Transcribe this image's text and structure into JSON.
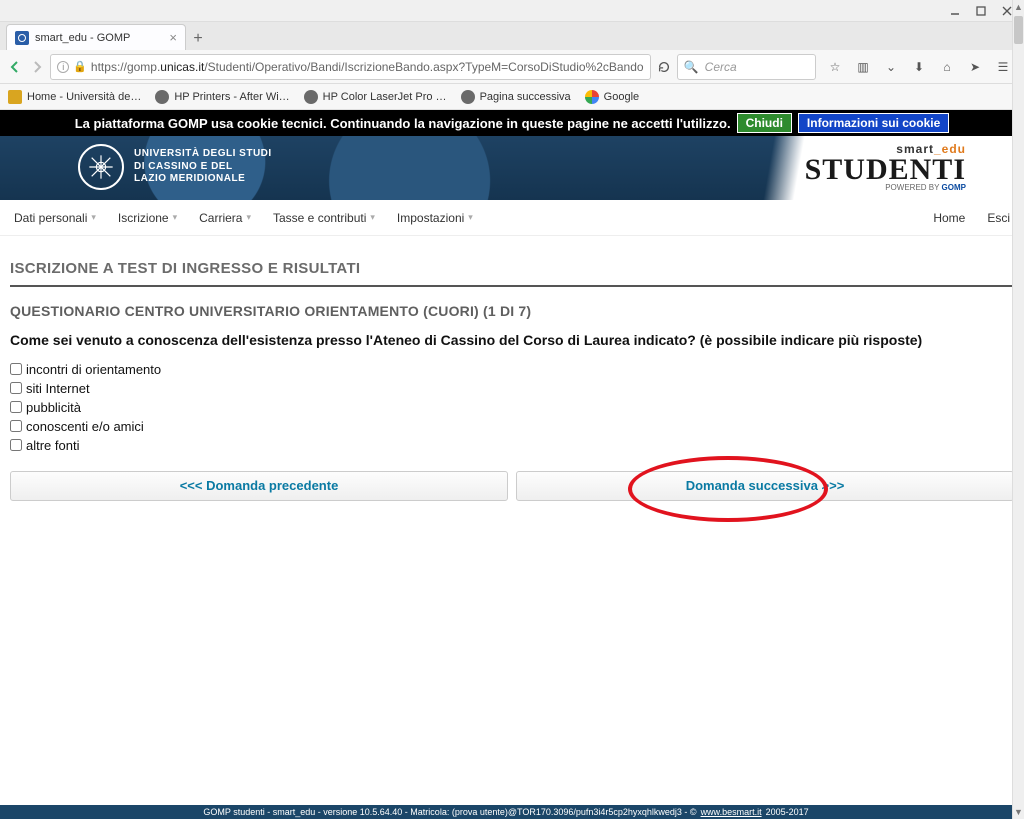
{
  "window": {
    "tab_title": "smart_edu - GOMP"
  },
  "nav": {
    "url_prefix": "https://gomp.",
    "url_domain": "unicas.it",
    "url_path": "/Studenti/Operativo/Bandi/IscrizioneBando.aspx?TypeM=CorsoDiStudio%2cBando",
    "search_placeholder": "Cerca"
  },
  "bookmarks": [
    {
      "label": "Home - Università de…",
      "icon": "page"
    },
    {
      "label": "HP Printers - After Wi…",
      "icon": "globe"
    },
    {
      "label": "HP Color LaserJet Pro …",
      "icon": "globe"
    },
    {
      "label": "Pagina successiva",
      "icon": "globe"
    },
    {
      "label": "Google",
      "icon": "google"
    }
  ],
  "cookie": {
    "text": "La piattaforma GOMP usa cookie tecnici. Continuando la navigazione in queste pagine ne accetti l'utilizzo.",
    "close": "Chiudi",
    "info": "Informazioni sui cookie"
  },
  "university": {
    "line1": "UNIVERSITÀ DEGLI STUDI",
    "line2": "DI CASSINO E DEL",
    "line3": "LAZIO MERIDIONALE"
  },
  "brand": {
    "top_a": "smart",
    "top_b": "_edu",
    "main": "STUDENTI",
    "powered": "POWERED BY",
    "gomp": "GOMP"
  },
  "topnav": {
    "items": [
      "Dati personali",
      "Iscrizione",
      "Carriera",
      "Tasse e contributi",
      "Impostazioni"
    ],
    "home": "Home",
    "exit": "Esci"
  },
  "page": {
    "section_title": "ISCRIZIONE A TEST DI INGRESSO E RISULTATI",
    "q_title": "QUESTIONARIO CENTRO UNIVERSITARIO ORIENTAMENTO (CUORI) (1 DI 7)",
    "q_text": "Come sei venuto a conoscenza dell'esistenza presso l'Ateneo di Cassino del Corso di Laurea indicato? (è possibile indicare più risposte)",
    "options": [
      "incontri di orientamento",
      "siti Internet",
      "pubblicità",
      "conoscenti e/o amici",
      "altre fonti"
    ],
    "prev_btn": "<<< Domanda precedente",
    "next_btn": "Domanda successiva >>>"
  },
  "footer": {
    "text_a": "GOMP studenti - smart_edu - versione 10.5.64.40 - Matricola: (prova utente)@TOR170.3096/pufn3i4r5cp2hyxqhlkwedj3 - ©",
    "link": "www.besmart.it",
    "text_b": "2005-2017"
  }
}
